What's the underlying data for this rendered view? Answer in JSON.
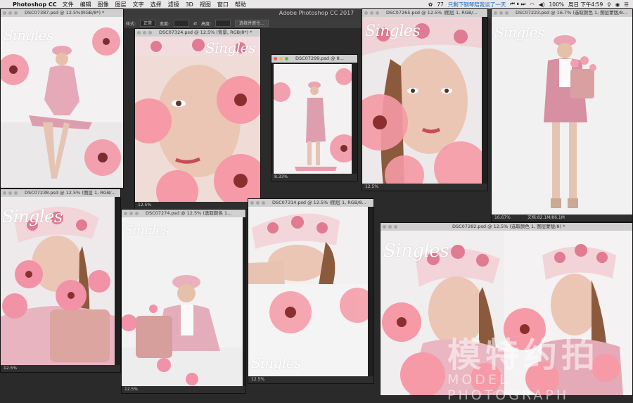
{
  "menubar": {
    "app": "Photoshop CC",
    "items": [
      "文件",
      "编辑",
      "图像",
      "图层",
      "文字",
      "选择",
      "滤镜",
      "3D",
      "视图",
      "窗口",
      "帮助"
    ],
    "badge": "77",
    "marquee": "只剩下钢琴陪我谈了一天",
    "battery": "100%",
    "clock": "周日 下午4:59"
  },
  "app_title": "Adobe Photoshop CC 2017",
  "options": {
    "style_label": "样式:",
    "style_value": "正常",
    "width_label": "宽度:",
    "height_label": "高度:",
    "select_mask": "选择并遮住..."
  },
  "documents": [
    {
      "tab": "DSC07387.psd @ 12.5%(RGB/8*) *"
    },
    {
      "tab": "DSC07324.psd @ 12.5% (背景, RGB/8*) *",
      "status": "12.5%"
    },
    {
      "tab": "DSC07299.psd @ 8...",
      "status": "8.33%"
    },
    {
      "tab": "DSC07265.psd @ 12.5% (图层 1, RGB/...",
      "status": "12.5%"
    },
    {
      "tab": "DSC07223.psd @ 16.7% (选取颜色 1, 图层蒙版/8...",
      "status": "16.67%",
      "status_extra": "文档:82.1M/86.1M"
    },
    {
      "tab": "DSC07238.psd @ 12.5% (图层 1, RGB/...",
      "status": "12.5%"
    },
    {
      "tab": "DSC07274.psd @ 12.5% (选取颜色 1...",
      "status": "12.5%"
    },
    {
      "tab": "DSC07314.psd @ 12.5% (图层 1, RGB/8...",
      "status": "12.5%"
    },
    {
      "tab": "DSC07282.psd @ 12.5% (选取颜色 1, 图层蒙版/8) *"
    }
  ],
  "brand": "Singles",
  "watermark": {
    "cn": "模特约拍",
    "en": "MODEL PHOTOGRAPH"
  },
  "colors": {
    "pink": "#e98fa0",
    "bg": "#f3f1f2",
    "menubar": "#e9e7e8"
  }
}
